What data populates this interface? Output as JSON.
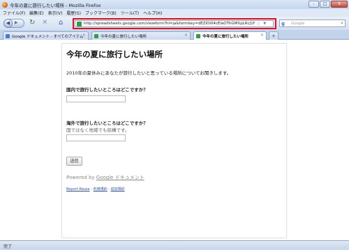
{
  "window": {
    "title": "今年の夏に旅行したい場所 - Mozilla Firefox",
    "controls": [
      "-",
      "□",
      "X"
    ]
  },
  "menu": [
    "ファイル(F)",
    "編集(E)",
    "表示(V)",
    "履歴(S)",
    "ブックマーク(B)",
    "ツール(T)",
    "ヘルプ(H)"
  ],
  "nav": {
    "back_glyph": "◀",
    "forward_glyph": "▶",
    "reload_glyph": "↻",
    "stop_glyph": "✕",
    "home_glyph": "⌂",
    "url": "http://spreadsheets.google.com/viewform?hl=ja&formkey=dEZlOi04cElaOThGMXpLRcJ1N",
    "star_glyph": "☆",
    "dropdown_glyph": "▼",
    "search_engine_glyph": "g",
    "search_placeholder": "Google",
    "search_glyph": "⌕"
  },
  "tabs": [
    {
      "label": "Google ドキュメント - すべてのアイテム",
      "close": "×",
      "icon_color": "#4a7ad8"
    },
    {
      "label": "今年の夏に旅行したい場所",
      "close": "×",
      "icon_color": "#2f9e44"
    },
    {
      "label": "今年の夏に旅行したい場所",
      "close": "×",
      "icon_color": "#2f9e44"
    }
  ],
  "new_tab_label": "+",
  "form": {
    "title": "今年の夏に旅行したい場所",
    "description": "2010年の夏休みにあなたが旅行したいと思っている場所についてお聞きします。",
    "questions": [
      {
        "title": "国内で旅行したいところはどこですか？",
        "help": ""
      },
      {
        "title": "海外で旅行したいところはどこですか？",
        "help": "国ではなく地域でも結構です。"
      }
    ],
    "submit": "送信",
    "powered_prefix": "Powered by ",
    "powered_brand": "Google ドキュメント",
    "footer": {
      "report": "Report Abuse",
      "sep1": " - ",
      "terms": "利用規約",
      "sep2": " - ",
      "extra": "追加規約"
    }
  },
  "status": {
    "text": "完了",
    "grip": "⋰"
  }
}
